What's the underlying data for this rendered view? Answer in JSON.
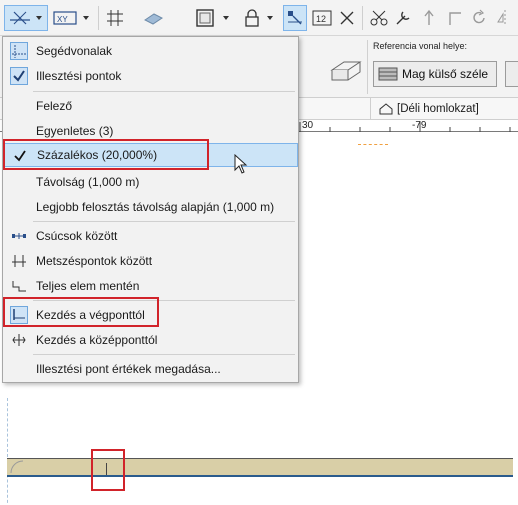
{
  "menu": {
    "items": [
      {
        "label": "Segédvonalak"
      },
      {
        "label": "Illesztési pontok"
      },
      {
        "label": "Felező"
      },
      {
        "label": "Egyenletes (3)"
      },
      {
        "label": "Százalékos (20,000%)"
      },
      {
        "label": "Távolság (1,000 m)"
      },
      {
        "label": "Legjobb felosztás távolság alapján (1,000 m)"
      },
      {
        "label": "Csúcsok között"
      },
      {
        "label": "Metszéspontok között"
      },
      {
        "label": "Teljes elem mentén"
      },
      {
        "label": "Kezdés a végponttól"
      },
      {
        "label": "Kezdés a középponttól"
      },
      {
        "label": "Illesztési pont értékek megadása..."
      }
    ]
  },
  "infobar": {
    "ref_label": "Referencia vonal helye:",
    "ref_value": "Mag külső széle"
  },
  "tab": {
    "label": "[Déli homlokzat]"
  },
  "ruler": {
    "labels": [
      "30",
      "-79"
    ]
  },
  "toolbar": {
    "units_label": "12"
  },
  "colors": {
    "highlight": "#cce4f7",
    "highlight_border": "#7eb4ea",
    "annotation_red": "#d1232a",
    "wall_fill": "#d9cfa7"
  }
}
